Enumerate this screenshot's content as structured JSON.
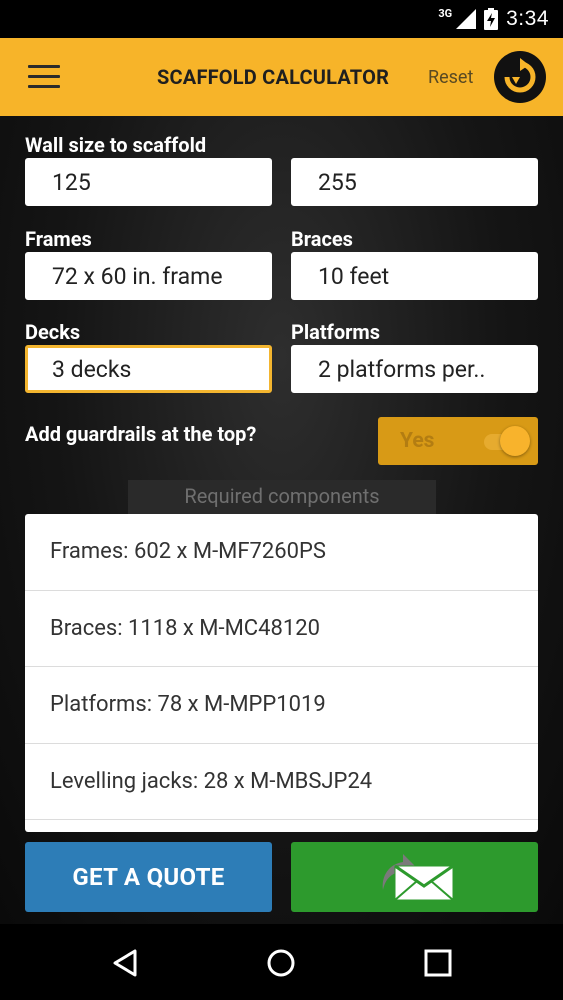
{
  "status_bar": {
    "network": "3G",
    "time": "3:34"
  },
  "app_bar": {
    "title": "SCAFFOLD CALCULATOR",
    "reset_label": "Reset"
  },
  "form": {
    "wall_size": {
      "label": "Wall size to scaffold",
      "width": "125",
      "height": "255"
    },
    "frames": {
      "label": "Frames",
      "value": "72 x 60 in. frame"
    },
    "braces": {
      "label": "Braces",
      "value": "10 feet"
    },
    "decks": {
      "label": "Decks",
      "value": "3 decks"
    },
    "platforms": {
      "label": "Platforms",
      "value": "2 platforms per.."
    },
    "guardrails": {
      "label": "Add guardrails at the top?",
      "toggle_label": "Yes"
    }
  },
  "results": {
    "header": "Required components",
    "items": [
      "Frames: 602 x M-MF7260PS",
      "Braces: 1118 x M-MC48120",
      "Platforms: 78 x M-MPP1019",
      "Levelling jacks: 28 x M-MBSJP24"
    ]
  },
  "actions": {
    "quote_label": "GET A QUOTE"
  },
  "colors": {
    "accent": "#f7b429",
    "quote": "#2d7db7",
    "email": "#2d9a2d"
  }
}
